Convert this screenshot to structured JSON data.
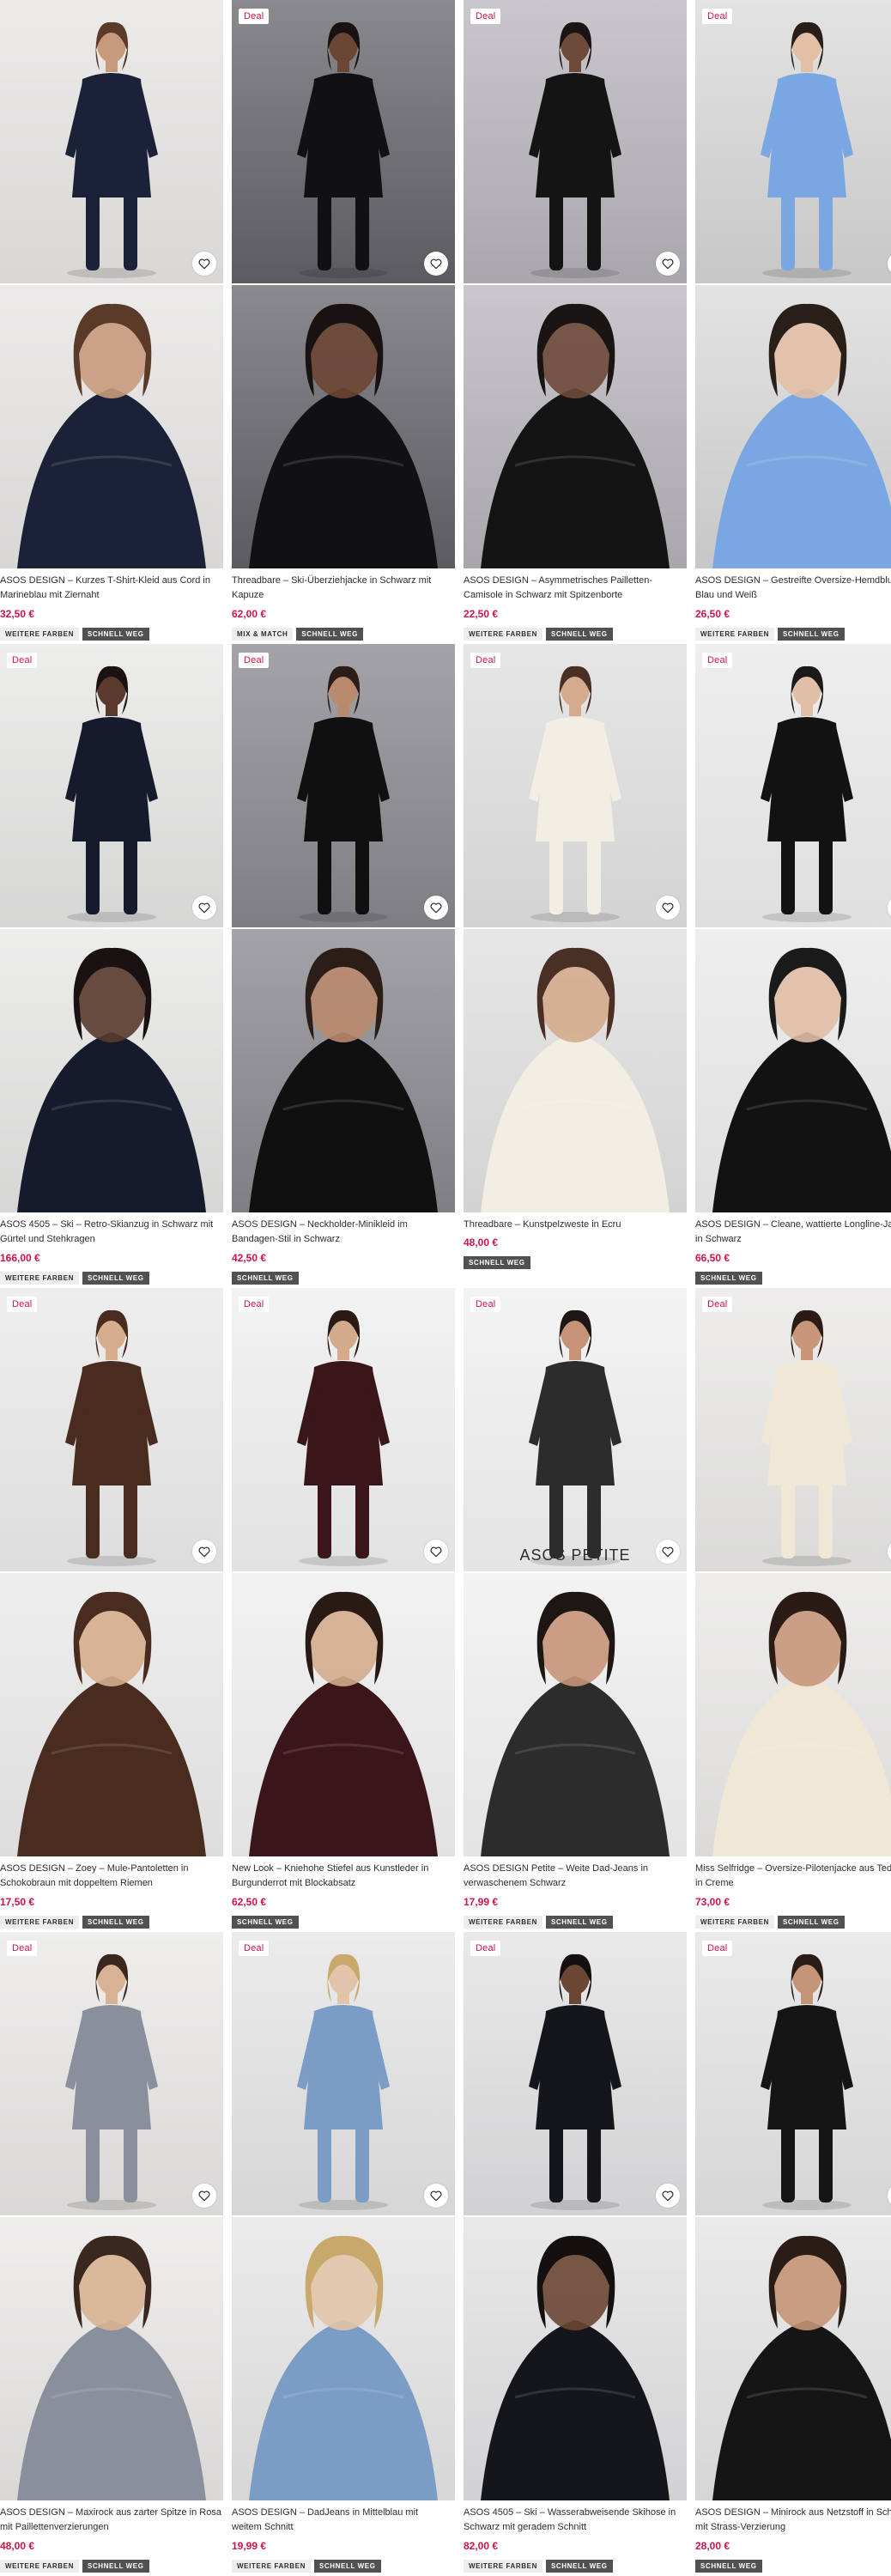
{
  "colors": {
    "deal": "#d01345",
    "price": "#d01345",
    "badge_dark": "#525050",
    "badge_light": "#eeeeee"
  },
  "labels": {
    "deal": "Deal",
    "petite_logo": "ASOS PETITE"
  },
  "products": [
    {
      "title_lines": [
        "ASOS DESIGN – Kurzes T-Shirt-Kleid aus Cord in",
        "Marineblau mit Ziernaht"
      ],
      "price": "32,50 €",
      "deal": false,
      "badges": [
        "WEITERE FARBEN",
        "SCHNELL WEG"
      ],
      "image_main": "navy dress",
      "image_alt": "navy dress sleeve detail"
    },
    {
      "title_lines": [
        "Threadbare – Ski-Überziehjacke in Schwarz mit",
        "Kapuze"
      ],
      "price": "62,00 €",
      "deal": true,
      "badges": [
        "MIX & MATCH",
        "SCHNELL WEG"
      ],
      "image_main": "black ski jacket",
      "image_alt": "black hooded jacket close-up"
    },
    {
      "title_lines": [
        "ASOS DESIGN – Asymmetrisches Pailletten-",
        "Camisole in Schwarz mit Spitzenborte"
      ],
      "price": "22,50 €",
      "deal": true,
      "badges": [
        "WEITERE FARBEN",
        "SCHNELL WEG"
      ],
      "image_main": "black sequin camisole",
      "image_alt": "sequin camisole back view"
    },
    {
      "title_lines": [
        "ASOS DESIGN – Gestreifte Oversize-Hemdbluse in",
        "Blau und Weiß"
      ],
      "price": "26,50 €",
      "deal": true,
      "badges": [
        "WEITERE FARBEN",
        "SCHNELL WEG"
      ],
      "image_main": "blue striped shirt",
      "image_alt": "striped shirt close-up"
    },
    {
      "title_lines": [
        "ASOS 4505 – Ski – Retro-Skianzug in Schwarz mit",
        "Gürtel und Stehkragen"
      ],
      "price": "166,00 €",
      "deal": true,
      "badges": [
        "WEITERE FARBEN",
        "SCHNELL WEG"
      ],
      "image_main": "black ski suit",
      "image_alt": "ski suit collar detail"
    },
    {
      "title_lines": [
        "ASOS DESIGN – Neckholder-Minikleid im",
        "Bandagen-Stil in Schwarz"
      ],
      "price": "42,50 €",
      "deal": true,
      "badges": [
        "SCHNELL WEG"
      ],
      "image_main": "black halter mini dress",
      "image_alt": "bandage dress full view"
    },
    {
      "title_lines": [
        "Threadbare – Kunstpelzweste in Ecru"
      ],
      "price": "48,00 €",
      "deal": true,
      "badges": [
        "SCHNELL WEG"
      ],
      "image_main": "ecru faux fur vest",
      "image_alt": "faux fur texture detail"
    },
    {
      "title_lines": [
        "ASOS DESIGN – Cleane, wattierte Longline-Jacke",
        "in Schwarz"
      ],
      "price": "66,50 €",
      "deal": true,
      "badges": [
        "SCHNELL WEG"
      ],
      "image_main": "black longline coat",
      "image_alt": "black coat back view"
    },
    {
      "title_lines": [
        "ASOS DESIGN – Zoey – Mule-Pantoletten in",
        "Schokobraun mit doppeltem Riemen"
      ],
      "price": "17,50 €",
      "deal": true,
      "badges": [
        "WEITERE FARBEN",
        "SCHNELL WEG"
      ],
      "image_main": "brown fluffy slides",
      "image_alt": "slides side view"
    },
    {
      "title_lines": [
        "New Look – Kniehohe Stiefel aus Kunstleder in",
        "Burgunderrot mit Blockabsatz"
      ],
      "price": "62,50 €",
      "deal": true,
      "badges": [
        "SCHNELL WEG"
      ],
      "image_main": "burgundy knee boots",
      "image_alt": "boot buckle detail"
    },
    {
      "title_lines": [
        "ASOS DESIGN Petite – Weite Dad-Jeans in",
        "verwaschenem Schwarz"
      ],
      "price": "17,99 €",
      "deal": true,
      "badges": [
        "WEITERE FARBEN",
        "SCHNELL WEG"
      ],
      "image_main": "washed black dad jeans",
      "image_alt": "jeans pocket detail",
      "petite": true
    },
    {
      "title_lines": [
        "Miss Selfridge – Oversize-Pilotenjacke aus Teddyfell",
        "in Creme"
      ],
      "price": "73,00 €",
      "deal": true,
      "badges": [
        "WEITERE FARBEN",
        "SCHNELL WEG"
      ],
      "image_main": "cream teddy aviator jacket",
      "image_alt": "teddy jacket close-up"
    },
    {
      "title_lines": [
        "ASOS DESIGN – Maxirock aus zarter Spitze in Rosa",
        "mit Paillettenverzierungen"
      ],
      "price": "48,00 €",
      "deal": true,
      "badges": [
        "WEITERE FARBEN",
        "SCHNELL WEG"
      ],
      "image_main": "pink lace maxi skirt",
      "image_alt": "sequin lace detail"
    },
    {
      "title_lines": [
        "ASOS DESIGN – DadJeans in Mittelblau mit",
        "weitem Schnitt"
      ],
      "price": "19,99 €",
      "deal": true,
      "badges": [
        "WEITERE FARBEN",
        "SCHNELL WEG"
      ],
      "image_main": "mid blue wide jeans",
      "image_alt": "jeans back view"
    },
    {
      "title_lines": [
        "ASOS 4505 – Ski – Wasserabweisende Skihose in",
        "Schwarz mit geradem Schnitt"
      ],
      "price": "82,00 €",
      "deal": true,
      "badges": [
        "WEITERE FARBEN",
        "SCHNELL WEG"
      ],
      "image_main": "black ski trousers",
      "image_alt": "ski trousers side view"
    },
    {
      "title_lines": [
        "ASOS DESIGN – Minirock aus Netzstoff in Schwarz",
        "mit Strass-Verzierung"
      ],
      "price": "28,00 €",
      "deal": true,
      "badges": [
        "SCHNELL WEG"
      ],
      "image_main": "black embellished mini skirt",
      "image_alt": "rhinestone mesh detail"
    }
  ]
}
